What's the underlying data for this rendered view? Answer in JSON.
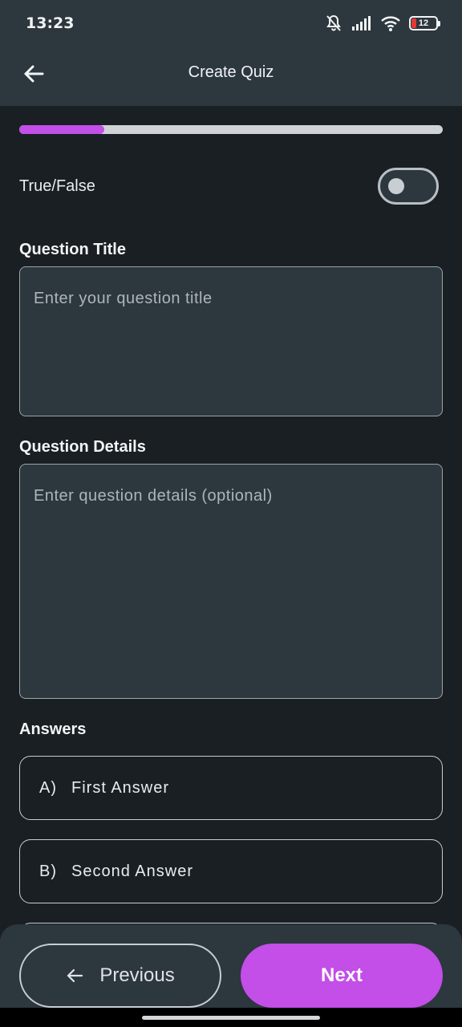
{
  "status_bar": {
    "time": "13:23",
    "battery_level": "12",
    "icons": [
      "bell-muted-icon",
      "signal-icon",
      "wifi-icon",
      "battery-icon"
    ]
  },
  "app_bar": {
    "title": "Create Quiz",
    "back_icon": "arrow-left-icon"
  },
  "progress": {
    "value": 0.2,
    "color": "#c34ee8"
  },
  "true_false": {
    "label": "True/False",
    "enabled": false
  },
  "question_title": {
    "label": "Question Title",
    "placeholder": "Enter your question title"
  },
  "question_details": {
    "label": "Question Details",
    "placeholder": "Enter question details (optional)"
  },
  "answers": {
    "label": "Answers",
    "items": [
      {
        "letter": "A)",
        "text": "First Answer"
      },
      {
        "letter": "B)",
        "text": "Second Answer"
      }
    ]
  },
  "footer": {
    "previous_label": "Previous",
    "next_label": "Next",
    "previous_icon": "arrow-left-icon"
  },
  "colors": {
    "accent": "#c34ee8",
    "background": "#1a1f24",
    "surface": "#2c373e"
  }
}
